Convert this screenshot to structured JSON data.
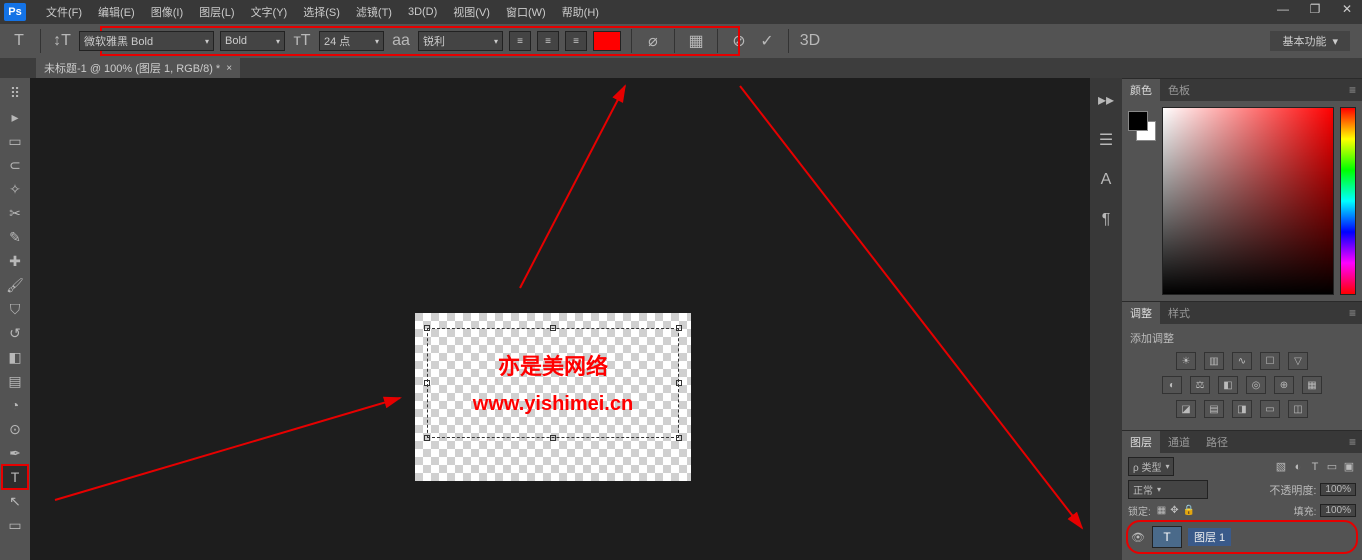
{
  "app": {
    "logo": "Ps"
  },
  "menu": {
    "file": "文件(F)",
    "edit": "编辑(E)",
    "image": "图像(I)",
    "layer": "图层(L)",
    "type": "文字(Y)",
    "select": "选择(S)",
    "filter": "滤镜(T)",
    "threeD": "3D(D)",
    "view": "视图(V)",
    "window": "窗口(W)",
    "help": "帮助(H)"
  },
  "window_controls": {
    "min": "—",
    "restore": "❐",
    "close": "✕"
  },
  "options": {
    "font": "微软雅黑 Bold",
    "weight": "Bold",
    "size": "24 点",
    "aa_label": "aa",
    "aa": "锐利",
    "color_hex": "#ff0000",
    "threeD": "3D",
    "workspace": "基本功能"
  },
  "doc_tab": {
    "title": "未标题-1 @ 100% (图层 1, RGB/8) *",
    "close": "×"
  },
  "canvas_text": {
    "line1": "亦是美网络",
    "line2": "www.yishimei.cn"
  },
  "panels": {
    "color_tab": "颜色",
    "swatch_tab": "色板",
    "adjust_tab": "调整",
    "style_tab": "样式",
    "adjust_subtitle": "添加调整",
    "layers_tab": "图层",
    "channels_tab": "通道",
    "paths_tab": "路径",
    "kind_label": "ρ 类型",
    "blend_mode": "正常",
    "opacity_label": "不透明度:",
    "opacity_val": "100%",
    "lock_label": "锁定:",
    "fill_label": "填充:",
    "fill_val": "100%",
    "layer1_name": "图层 1",
    "layer1_thumb": "T"
  }
}
